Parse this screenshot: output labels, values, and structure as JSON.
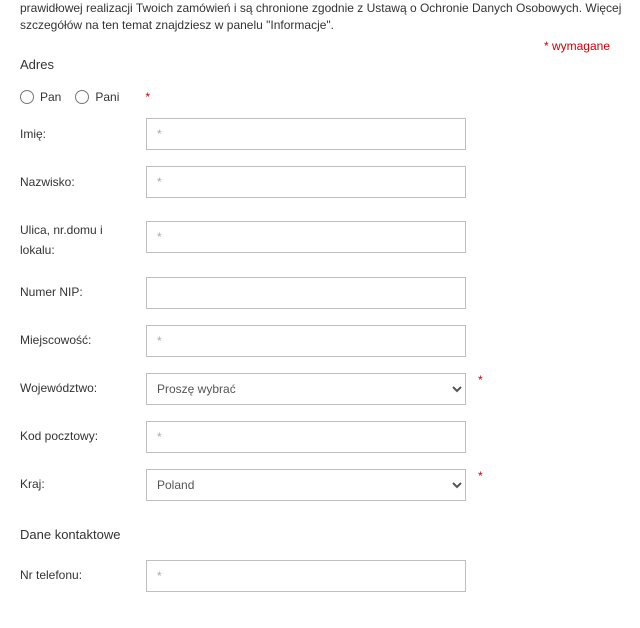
{
  "intro_text": "prawidłowej realizacji Twoich zamówień i są chronione zgodnie z Ustawą o Ochronie Danych Osobowych. Więcej szczegółów na ten temat znajdziesz w panelu \"Informacje\".",
  "required_note": "* wymagane",
  "section_address": "Adres",
  "section_contact": "Dane kontaktowe",
  "placeholder_star": "*",
  "asterisk": "*",
  "gender": {
    "mr": "Pan",
    "mrs": "Pani"
  },
  "labels": {
    "firstname": "Imię:",
    "lastname": "Nazwisko:",
    "street": "Ulica, nr.domu i lokalu:",
    "nip": "Numer NIP:",
    "city": "Miejscowość:",
    "province": "Województwo:",
    "postcode": "Kod pocztowy:",
    "country": "Kraj:",
    "phone": "Nr telefonu:"
  },
  "province_placeholder": "Proszę wybrać",
  "country_value": "Poland"
}
